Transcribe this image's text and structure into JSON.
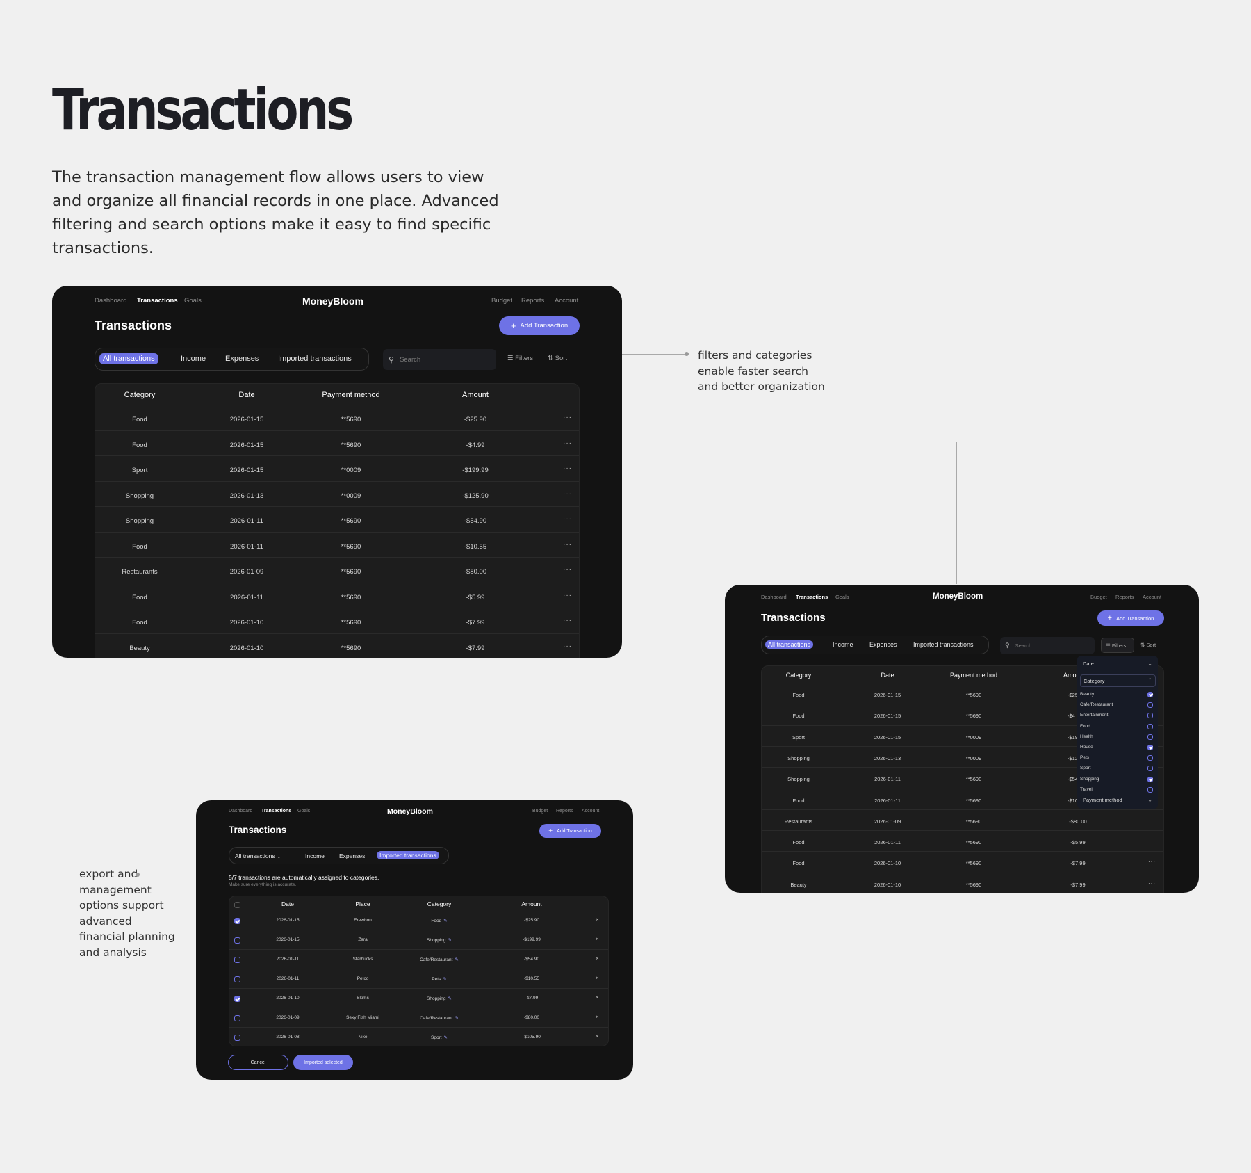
{
  "hero": {
    "title": "Transactions",
    "description": "The transaction management flow allows users to view and organize all financial records in one place. Advanced filtering and search options make it easy to find specific transactions."
  },
  "notes": {
    "filters_lines": [
      "filters and categories",
      "enable faster search",
      "and better organization"
    ],
    "export_lines": [
      "export and",
      "management",
      "options support",
      "advanced",
      "financial planning",
      "and analysis"
    ]
  },
  "app": {
    "nav_left": [
      "Dashboard",
      "Transactions",
      "Goals"
    ],
    "brand": "MoneyBloom",
    "nav_right": [
      "Budget",
      "Reports",
      "Account"
    ],
    "page_title": "Transactions",
    "add_button": "Add Transaction",
    "tabs": [
      "All transactions",
      "Income",
      "Expenses",
      "Imported transactions"
    ],
    "search_placeholder": "Search",
    "filters_label": "Filters",
    "sort_label": "Sort",
    "accent": "#6e72e6"
  },
  "transactions": {
    "columns": [
      "Category",
      "Date",
      "Payment method",
      "Amount"
    ],
    "rows": [
      {
        "category": "Food",
        "date": "2026-01-15",
        "payment": "**5690",
        "amount": "-$25.90"
      },
      {
        "category": "Food",
        "date": "2026-01-15",
        "payment": "**5690",
        "amount": "-$4.99"
      },
      {
        "category": "Sport",
        "date": "2026-01-15",
        "payment": "**0009",
        "amount": "-$199.99"
      },
      {
        "category": "Shopping",
        "date": "2026-01-13",
        "payment": "**0009",
        "amount": "-$125.90"
      },
      {
        "category": "Shopping",
        "date": "2026-01-11",
        "payment": "**5690",
        "amount": "-$54.90"
      },
      {
        "category": "Food",
        "date": "2026-01-11",
        "payment": "**5690",
        "amount": "-$10.55"
      },
      {
        "category": "Restaurants",
        "date": "2026-01-09",
        "payment": "**5690",
        "amount": "-$80.00"
      },
      {
        "category": "Food",
        "date": "2026-01-11",
        "payment": "**5690",
        "amount": "-$5.99"
      },
      {
        "category": "Food",
        "date": "2026-01-10",
        "payment": "**5690",
        "amount": "-$7.99"
      },
      {
        "category": "Beauty",
        "date": "2026-01-10",
        "payment": "**5690",
        "amount": "-$7.99"
      }
    ],
    "more_label": "···"
  },
  "filter_panel": {
    "date_label": "Date",
    "category_label": "Category",
    "categories": [
      {
        "name": "Beauty",
        "checked": true
      },
      {
        "name": "Cafe/Restaurant",
        "checked": false
      },
      {
        "name": "Entertainment",
        "checked": false
      },
      {
        "name": "Food",
        "checked": false
      },
      {
        "name": "Health",
        "checked": false
      },
      {
        "name": "House",
        "checked": true
      },
      {
        "name": "Pets",
        "checked": false
      },
      {
        "name": "Sport",
        "checked": false
      },
      {
        "name": "Shopping",
        "checked": true
      },
      {
        "name": "Travel",
        "checked": false
      }
    ],
    "payment_label": "Payment method",
    "partial_amounts": [
      "-$25",
      "-$4",
      "-$19",
      "-$12",
      "-$54",
      "-$10"
    ],
    "partial_amount_header": "Amo"
  },
  "import": {
    "tab_dropdown_label": "All transactions",
    "summary": "5/7 transactions are automatically assigned to categories.",
    "hint": "Make sure everything is accurate.",
    "columns": [
      "Date",
      "Place",
      "Category",
      "Amount"
    ],
    "rows": [
      {
        "checked": true,
        "date": "2026-01-15",
        "place": "Erewhon",
        "category": "Food",
        "amount": "-$25.90"
      },
      {
        "checked": false,
        "date": "2026-01-15",
        "place": "Zara",
        "category": "Shopping",
        "amount": "-$199.99"
      },
      {
        "checked": false,
        "date": "2026-01-11",
        "place": "Starbucks",
        "category": "Cafe/Restaurant",
        "amount": "-$54.90"
      },
      {
        "checked": false,
        "date": "2026-01-11",
        "place": "Petco",
        "category": "Pets",
        "amount": "-$10.55"
      },
      {
        "checked": true,
        "date": "2026-01-10",
        "place": "Skims",
        "category": "Shopping",
        "amount": "-$7.99"
      },
      {
        "checked": false,
        "date": "2026-01-09",
        "place": "Sexy Fish Miami",
        "category": "Cafe/Restaurant",
        "amount": "-$80.00"
      },
      {
        "checked": false,
        "date": "2026-01-08",
        "place": "Nike",
        "category": "Sport",
        "amount": "-$105.90"
      }
    ],
    "remove_label": "×",
    "edit_icon": "✎",
    "cancel_label": "Cancel",
    "confirm_label": "Imported selected"
  }
}
